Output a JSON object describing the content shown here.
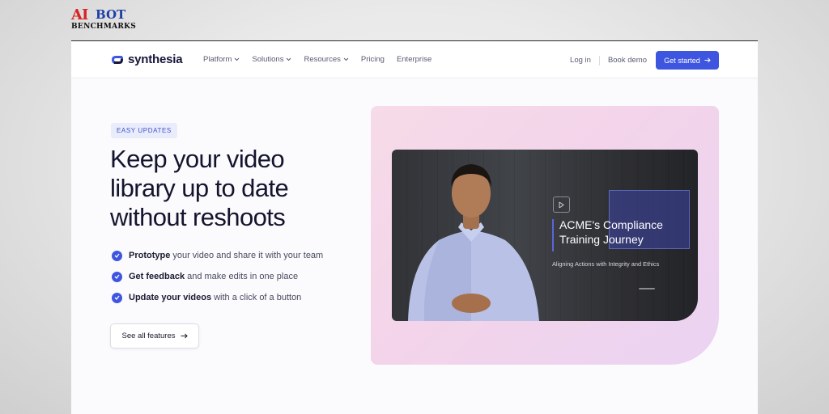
{
  "watermark": {
    "line1a": "AI",
    "line1b": "BOT",
    "line2": "BENCHMARKS"
  },
  "nav": {
    "brand": "synthesia",
    "menu": [
      {
        "label": "Platform",
        "has_dropdown": true
      },
      {
        "label": "Solutions",
        "has_dropdown": true
      },
      {
        "label": "Resources",
        "has_dropdown": true
      },
      {
        "label": "Pricing",
        "has_dropdown": false
      },
      {
        "label": "Enterprise",
        "has_dropdown": false
      }
    ],
    "login": "Log in",
    "book_demo": "Book demo",
    "get_started": "Get started"
  },
  "hero": {
    "badge": "EASY UPDATES",
    "headline": "Keep your video library up to date without reshoots",
    "features": [
      {
        "bold": "Prototype",
        "rest": "your video and share it with your team"
      },
      {
        "bold": "Get feedback",
        "rest": "and make edits in one place"
      },
      {
        "bold": "Update your videos",
        "rest": "with a click of a button"
      }
    ],
    "cta": "See all features"
  },
  "video": {
    "title": "ACME's Compliance Training Journey",
    "subtitle": "Aligning Actions with Integrity and Ethics"
  },
  "colors": {
    "accent": "#3e55e0",
    "brand_text": "#16163a",
    "panel_pink": "#f3d4ea"
  },
  "icons": [
    "synthesia-logo-icon",
    "chevron-down-icon",
    "arrow-right-icon",
    "check-circle-icon",
    "video-logo-icon"
  ]
}
